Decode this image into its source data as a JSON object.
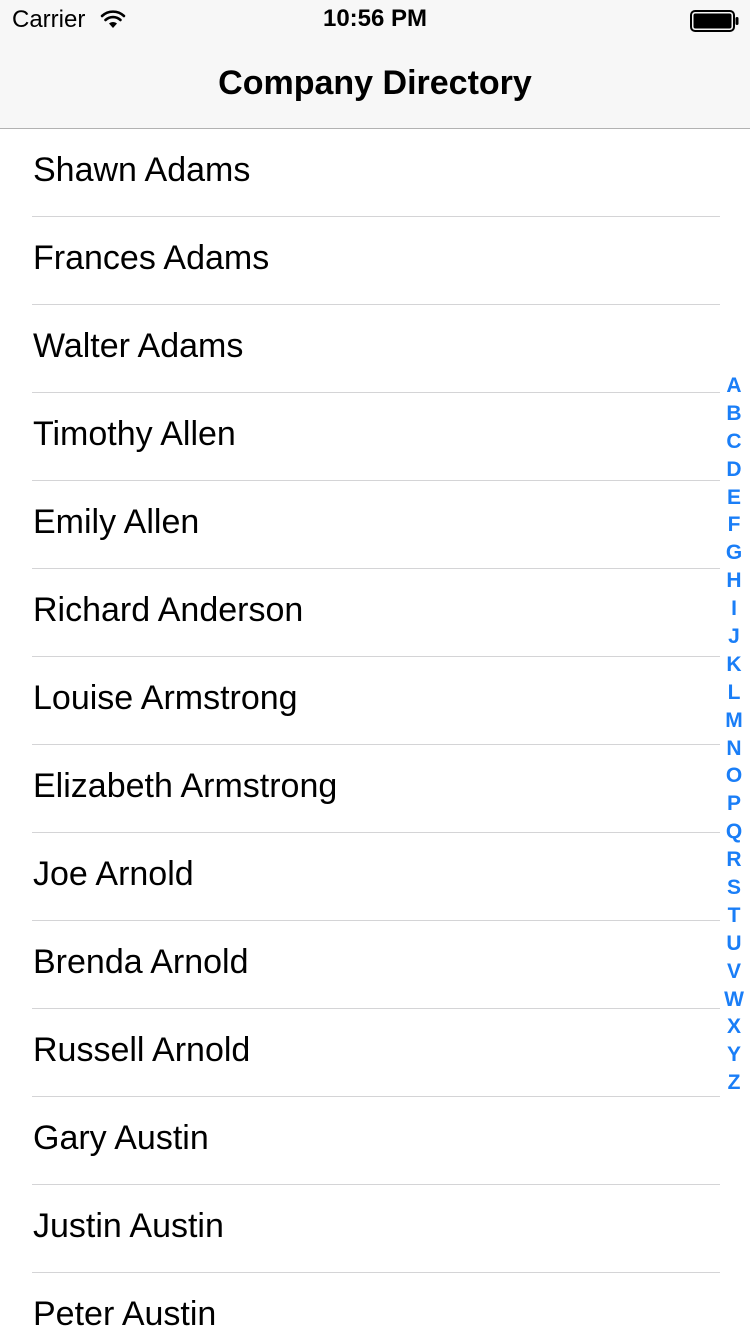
{
  "status_bar": {
    "carrier": "Carrier",
    "time": "10:56 PM",
    "wifi_icon": "wifi-icon",
    "battery_icon": "battery-icon"
  },
  "nav": {
    "title": "Company Directory"
  },
  "contacts": [
    "Shawn Adams",
    "Frances Adams",
    "Walter Adams",
    "Timothy Allen",
    "Emily Allen",
    "Richard Anderson",
    "Louise Armstrong",
    "Elizabeth Armstrong",
    "Joe Arnold",
    "Brenda Arnold",
    "Russell Arnold",
    "Gary Austin",
    "Justin Austin",
    "Peter Austin"
  ],
  "index_letters": [
    "A",
    "B",
    "C",
    "D",
    "E",
    "F",
    "G",
    "H",
    "I",
    "J",
    "K",
    "L",
    "M",
    "N",
    "O",
    "P",
    "Q",
    "R",
    "S",
    "T",
    "U",
    "V",
    "W",
    "X",
    "Y",
    "Z"
  ],
  "colors": {
    "accent": "#1a7ef7",
    "bar_background": "#f7f7f7",
    "separator": "#d4d4d6"
  }
}
